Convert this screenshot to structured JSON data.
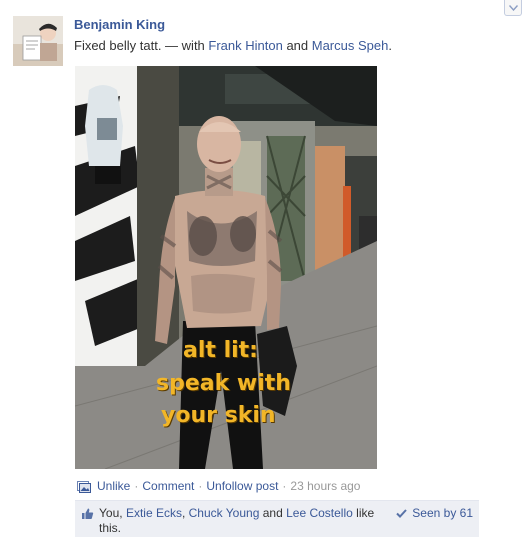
{
  "post": {
    "author": "Benjamin King",
    "status_text": "Fixed belly tatt.",
    "with_prefix": " — with ",
    "tag1": "Frank Hinton",
    "and_word": " and ",
    "tag2": "Marcus Speh",
    "period": ".",
    "photo_overlay": {
      "line1": "alt lit:",
      "line2": "speak with",
      "line3": "your skin"
    }
  },
  "actions": {
    "unlike": "Unlike",
    "sep": "·",
    "comment": "Comment",
    "unfollow": "Unfollow post",
    "time": "23 hours ago"
  },
  "likes": {
    "you": "You,",
    "person1": "Extie Ecks",
    "comma": ",",
    "person2": "Chuck Young",
    "and_word": "and",
    "person3": "Lee Costello",
    "suffix": "like this.",
    "seen": "Seen by 61"
  },
  "colors": {
    "link": "#3b5998",
    "likes_bg": "#edeff4",
    "overlay_text": "#f2b628"
  }
}
